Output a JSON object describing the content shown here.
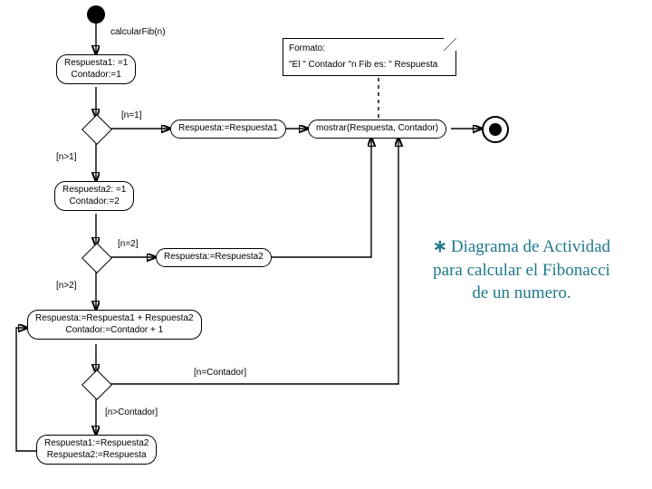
{
  "diagram": {
    "call_label": "calcularFib(n)",
    "activity_init1": "Respuesta1: =1\nContador:=1",
    "guard_n_eq_1": "[n=1]",
    "activity_resp_eq_r1": "Respuesta:=Respuesta1",
    "activity_mostrar": "mostrar(Respuesta, Contador)",
    "guard_n_gt_1": "[n>1]",
    "activity_init2": "Respuesta2: =1\nContador:=2",
    "guard_n_eq_2": "[n=2]",
    "activity_resp_eq_r2": "Respuesta:=Respuesta2",
    "guard_n_gt_2": "[n>2]",
    "activity_loop_body": "Respuesta:=Respuesta1 + Respuesta2\nContador:=Contador + 1",
    "guard_n_eq_cont": "[n=Contador]",
    "guard_n_gt_cont": "[n>Contador]",
    "activity_swap": "Respuesta1:=Respuesta2\nRespuesta2:=Respuesta",
    "note_title": "Formato:",
    "note_body": "\"El \" Contador \"n Fib es: \" Respuesta"
  },
  "caption": {
    "text_l1": "Diagrama de Actividad",
    "text_l2": "para calcular el Fibonacci",
    "text_l3": "de un numero."
  }
}
